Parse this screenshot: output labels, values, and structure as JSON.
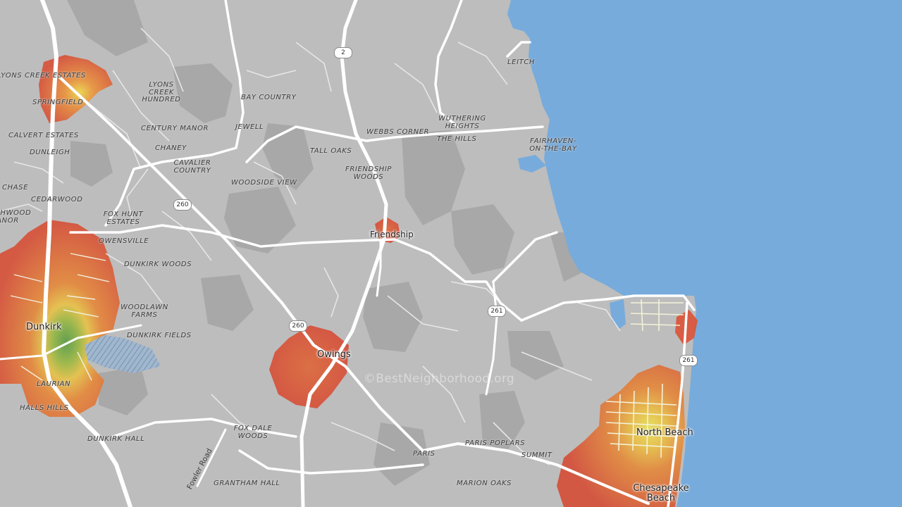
{
  "map": {
    "colors": {
      "land": "#bdbdbd",
      "parkland": "#a9a9a9",
      "water": "#77abdc",
      "roads": "#ffffff",
      "heat_high": "#d9553a",
      "heat_mid": "#e99b3f",
      "heat_low": "#6aa84f"
    },
    "towns": [
      {
        "name": "Dunkirk"
      },
      {
        "name": "Friendship"
      },
      {
        "name": "Owings"
      },
      {
        "name": "North Beach"
      },
      {
        "name": "Chesapeake Beach"
      }
    ],
    "places": [
      "LYONS CREEK ESTATES",
      "SPRINGFIELD",
      "LYONS CREEK HUNDRED",
      "CENTURY MANOR",
      "CALVERT ESTATES",
      "DUNLEIGH",
      "CHANEY",
      "CAVALIER COUNTRY",
      "CHASE",
      "CEDARWOOD",
      "FOX HUNT ESTATES",
      "OWENSVILLE",
      "DUNKIRK WOODS",
      "WOODLAWN FARMS",
      "DUNKIRK FIELDS",
      "LAURIAN",
      "HALLS HILLS",
      "DUNKIRK HALL",
      "ASHWOOD MANOR",
      "BAY COUNTRY",
      "JEWELL",
      "TALL OAKS",
      "WOODSIDE VIEW",
      "FRIENDSHIP WOODS",
      "WEBBS CORNER",
      "WUTHERING HEIGHTS",
      "THE HILLS",
      "LEITCH",
      "FAIRHAVEN-ON-THE-BAY",
      "FOX DALE WOODS",
      "GRANTHAM HALL",
      "PARIS",
      "PARIS POPLARS",
      "SUMMIT",
      "MARION OAKS"
    ],
    "road_labels": [
      "Fowler Road"
    ],
    "route_shields": [
      "2",
      "260",
      "260",
      "261",
      "261"
    ],
    "watermark": "©BestNeighborhood.org"
  }
}
